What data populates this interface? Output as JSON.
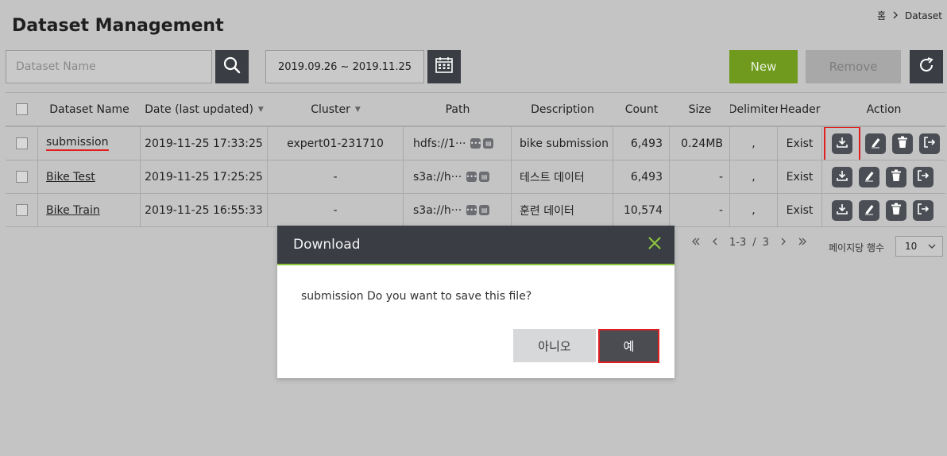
{
  "breadcrumb": {
    "home": "홈",
    "current": "Dataset"
  },
  "page": {
    "title": "Dataset Management"
  },
  "filters": {
    "name_placeholder": "Dataset Name",
    "date_range": "2019.09.26 ~ 2019.11.25"
  },
  "toolbar": {
    "new_label": "New",
    "remove_label": "Remove"
  },
  "table": {
    "columns": {
      "name": "Dataset Name",
      "date": "Date (last updated)",
      "cluster": "Cluster",
      "path": "Path",
      "description": "Description",
      "count": "Count",
      "size": "Size",
      "delimiter": "Delimiter",
      "header": "Header",
      "action": "Action"
    },
    "rows": [
      {
        "name": "submission",
        "date": "2019-11-25 17:33:25",
        "cluster": "expert01-231710",
        "path": "hdfs://1···",
        "description": "bike submission",
        "count": "6,493",
        "size": "0.24MB",
        "delimiter": ",",
        "header": "Exist"
      },
      {
        "name": "Bike Test",
        "date": "2019-11-25 17:25:25",
        "cluster": "-",
        "path": "s3a://h···",
        "description": "테스트 데이터",
        "count": "6,493",
        "size": "-",
        "delimiter": ",",
        "header": "Exist"
      },
      {
        "name": "Bike Train",
        "date": "2019-11-25 16:55:33",
        "cluster": "-",
        "path": "s3a://h···",
        "description": "훈련 데이터",
        "count": "10,574",
        "size": "-",
        "delimiter": ",",
        "header": "Exist"
      }
    ]
  },
  "pagination": {
    "range": "1-3",
    "separator": "/",
    "total": "3",
    "per_page_label": "페이지당 행수",
    "per_page_value": "10"
  },
  "modal": {
    "title": "Download",
    "message": "submission Do you want to save this file?",
    "no_label": "아니오",
    "yes_label": "예"
  },
  "colors": {
    "accent_green": "#6f9a1e",
    "dark": "#3a3d44",
    "highlight_red": "#e02020",
    "modal_line": "#8cc63f"
  },
  "icons": [
    "search-icon",
    "calendar-icon",
    "refresh-icon",
    "download-icon",
    "edit-icon",
    "trash-icon",
    "export-icon",
    "close-icon"
  ]
}
